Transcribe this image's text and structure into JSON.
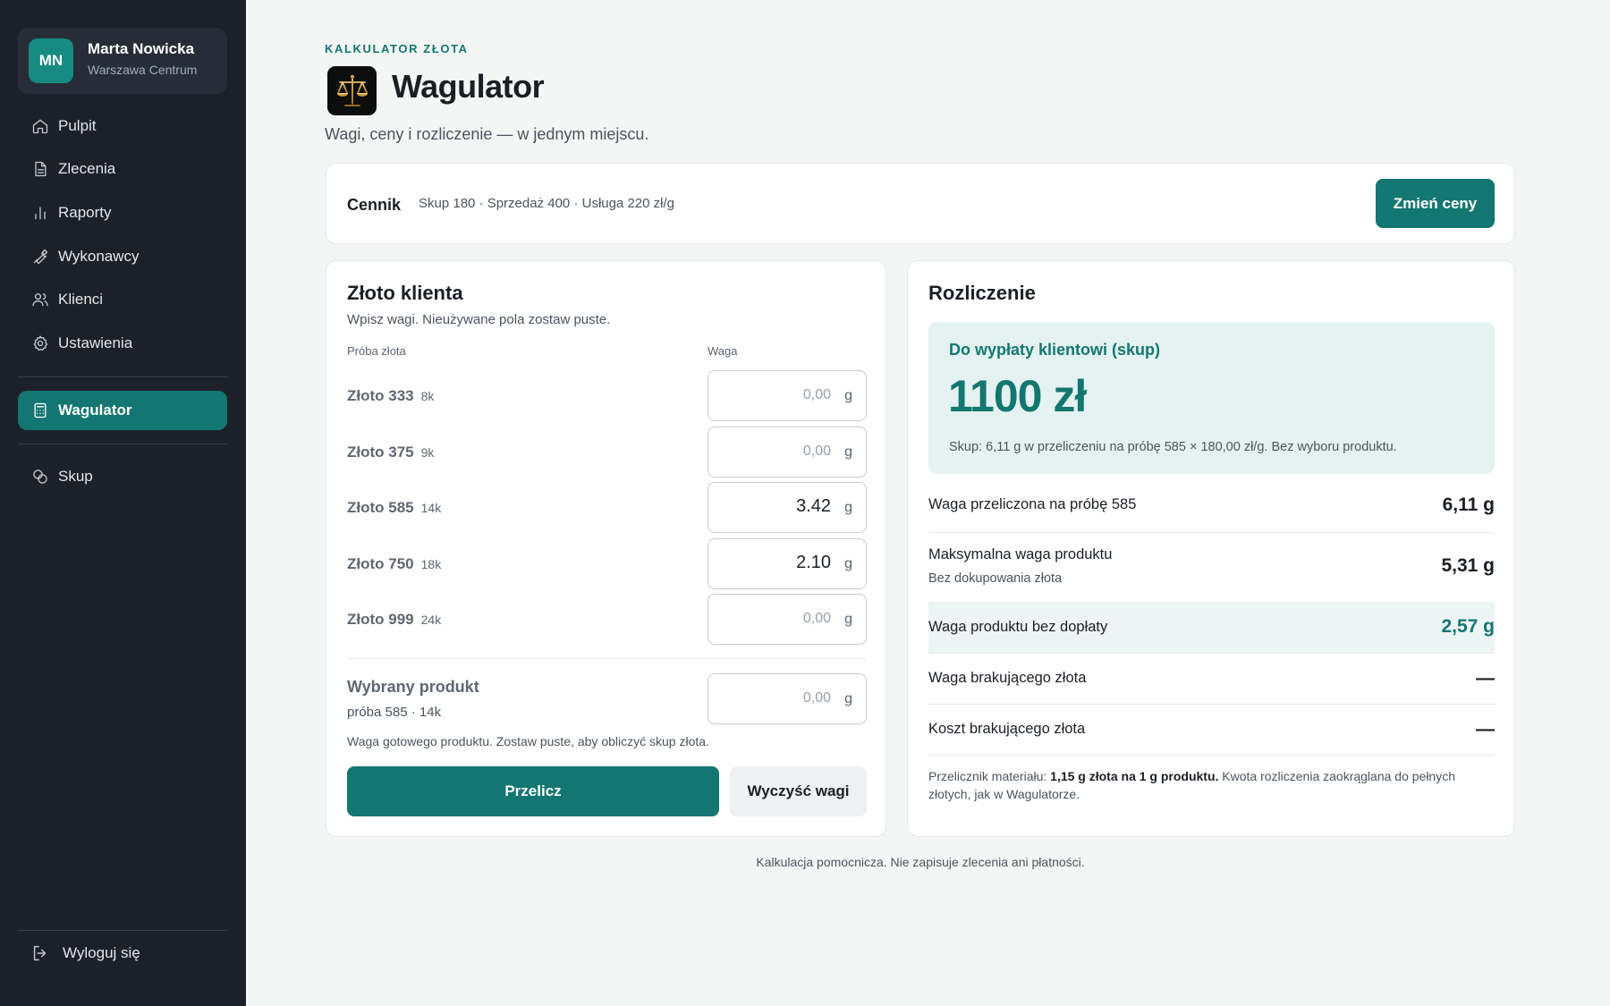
{
  "user": {
    "initials": "MN",
    "name": "Marta Nowicka",
    "location": "Warszawa Centrum"
  },
  "sidebar": {
    "items": [
      {
        "label": "Pulpit",
        "icon": "home-icon"
      },
      {
        "label": "Zlecenia",
        "icon": "document-icon"
      },
      {
        "label": "Raporty",
        "icon": "bar-chart-icon"
      },
      {
        "label": "Wykonawcy",
        "icon": "wrench-icon"
      },
      {
        "label": "Klienci",
        "icon": "users-icon"
      },
      {
        "label": "Ustawienia",
        "icon": "gear-icon"
      }
    ],
    "active_item": {
      "label": "Wagulator",
      "icon": "calculator-icon"
    },
    "extra_item": {
      "label": "Skup",
      "icon": "coins-icon"
    },
    "logout_label": "Wyloguj się"
  },
  "header": {
    "eyebrow": "KALKULATOR ZŁOTA",
    "title": "Wagulator",
    "subtitle": "Wagi, ceny i rozliczenie — w jednym miejscu."
  },
  "pricing": {
    "label": "Cennik",
    "values": "Skup 180 · Sprzedaż 400 · Usługa 220 zł/g",
    "button_label": "Zmień ceny"
  },
  "client_gold": {
    "title": "Złoto klienta",
    "hint": "Wpisz wagi. Nieużywane pola zostaw puste.",
    "col_purity": "Próba złota",
    "col_weight": "Waga",
    "unit": "g",
    "placeholder": "0,00",
    "rows": [
      {
        "label": "Złoto 333",
        "karat": "8k",
        "value": ""
      },
      {
        "label": "Złoto 375",
        "karat": "9k",
        "value": ""
      },
      {
        "label": "Złoto 585",
        "karat": "14k",
        "value": "3.42"
      },
      {
        "label": "Złoto 750",
        "karat": "18k",
        "value": "2.10"
      },
      {
        "label": "Złoto 999",
        "karat": "24k",
        "value": ""
      }
    ],
    "product_label": "Wybrany produkt",
    "product_sub": "próba 585 · 14k",
    "product_hint": "Waga gotowego produktu. Zostaw puste, aby obliczyć skup złota.",
    "calc_label": "Przelicz",
    "clear_label": "Wyczyść wagi"
  },
  "settlement": {
    "title": "Rozliczenie",
    "payout_label": "Do wypłaty klientowi (skup)",
    "payout_amount": "1100 zł",
    "payout_note": "Skup: 6,11 g w przeliczeniu na próbę 585 × 180,00 zł/g. Bez wyboru produktu.",
    "rows": [
      {
        "label": "Waga przeliczona na próbę 585",
        "value": "6,11 g"
      },
      {
        "label": "Maksymalna waga produktu",
        "sub": "Bez dokupowania złota",
        "value": "5,31 g"
      },
      {
        "label": "Waga produktu bez dopłaty",
        "value": "2,57 g"
      },
      {
        "label": "Waga brakującego złota",
        "value": "—"
      },
      {
        "label": "Koszt brakującego złota",
        "value": "—"
      }
    ],
    "footnote_prefix": "Przelicznik materiału: ",
    "footnote_bold": "1,15 g złota na 1 g produktu.",
    "footnote_suffix": " Kwota rozliczenia zaokrąglana do pełnych złotych, jak w Wagulatorze."
  },
  "bottom_note": "Kalkulacja pomocnicza. Nie zapisuje zlecenia ani płatności.",
  "colors": {
    "accent": "#137670",
    "sidebar_bg": "#1c2129",
    "payout_bg": "#e4f3f1"
  }
}
